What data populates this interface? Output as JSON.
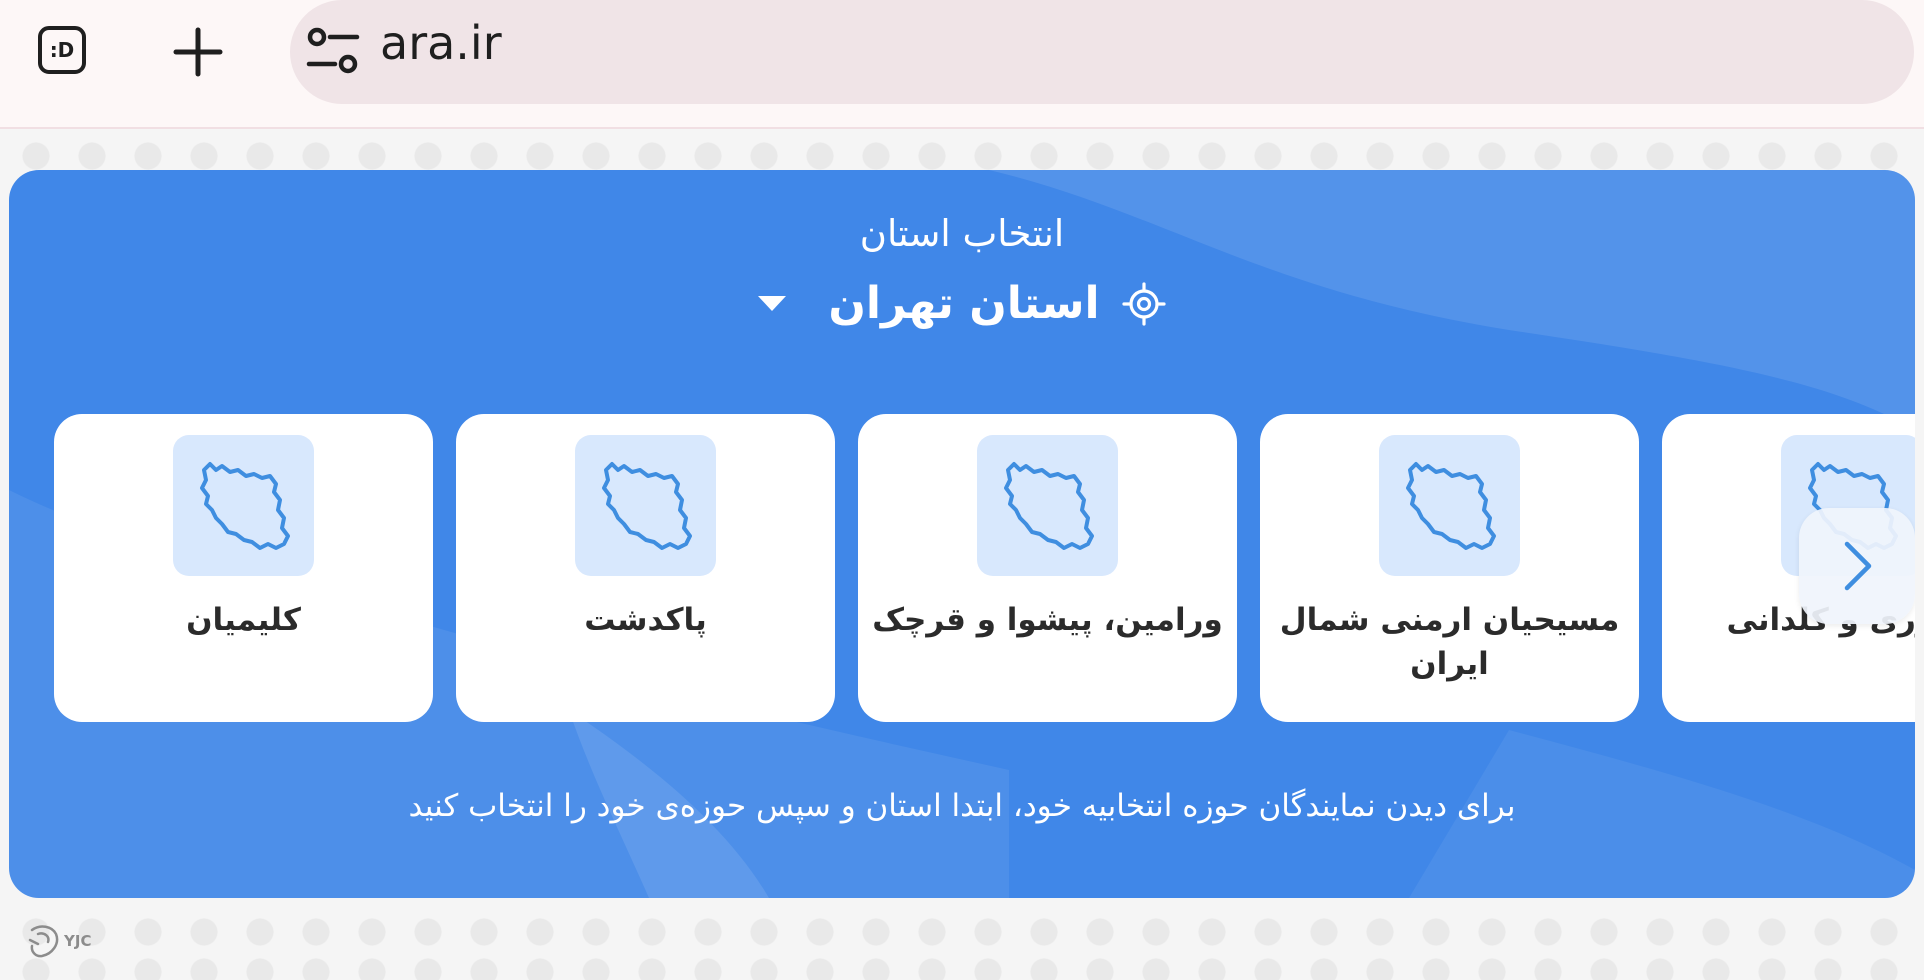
{
  "browser": {
    "tab_switcher_label": ":D",
    "url": "ara.ir",
    "icons": [
      "tab-switcher-icon",
      "plus-icon",
      "site-settings-icon"
    ]
  },
  "panel": {
    "title": "انتخاب استان",
    "province": "استان تهران",
    "cards": [
      {
        "name": "کلیمیان"
      },
      {
        "name": "پاکدشت"
      },
      {
        "name": "ورامین، پیشوا و قرچک"
      },
      {
        "name": "مسیحیان ارمنی شمال ایران"
      },
      {
        "name": "آشوری و کلدانی"
      }
    ],
    "hint": "برای دیدن نمایندگان حوزه انتخابیه خود، ابتدا استان و سپس حوزه‌ی خود را انتخاب کنید"
  },
  "watermark": {
    "text": "YJC"
  },
  "colors": {
    "panel_blue": "#4087e8",
    "thumb_bg": "#d8e8fd",
    "map_stroke": "#3f8ee0",
    "url_bar": "#f0e4e7"
  }
}
